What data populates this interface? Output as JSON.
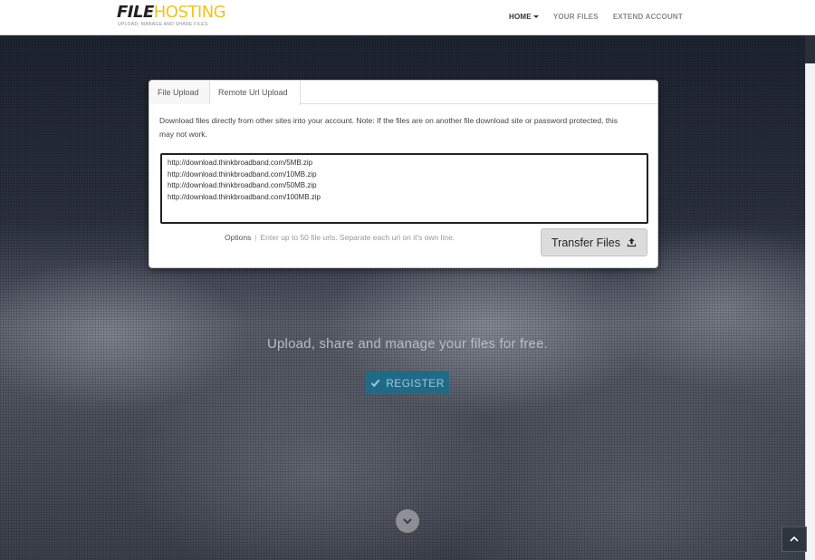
{
  "brand": {
    "logo_bold": "FILE",
    "logo_light": "HOSTING",
    "tagline": "UPLOAD, MANAGE AND SHARE FILES",
    "accent_color": "#f0c419"
  },
  "nav": {
    "items": [
      {
        "label": "HOME",
        "active": true
      },
      {
        "label": "YOUR FILES",
        "active": false
      },
      {
        "label": "EXTEND ACCOUNT",
        "active": false
      }
    ]
  },
  "upload_panel": {
    "tabs": [
      {
        "label": "File Upload",
        "active": false
      },
      {
        "label": "Remote Url Upload",
        "active": true
      }
    ],
    "description": "Download files directly from other sites into your account. Note: If the files are on another file download site or password protected, this may not work.",
    "urls_value": "http://download.thinkbroadband.com/5MB.zip\nhttp://download.thinkbroadband.com/10MB.zip\nhttp://download.thinkbroadband.com/50MB.zip\nhttp://download.thinkbroadband.com/100MB.zip",
    "options_label": "Options",
    "options_separator": "|",
    "options_hint": "Enter up to 50 file urls. Separate each url on it's own line.",
    "transfer_label": "Transfer Files",
    "transfer_icon": "upload-icon"
  },
  "hero": {
    "tagline": "Upload, share and manage your files for free.",
    "register_label": "REGISTER",
    "register_icon": "check-icon",
    "register_color": "#1f6a87",
    "scroll_down_icon": "chevron-down-icon",
    "back_to_top_icon": "chevron-up-icon"
  }
}
